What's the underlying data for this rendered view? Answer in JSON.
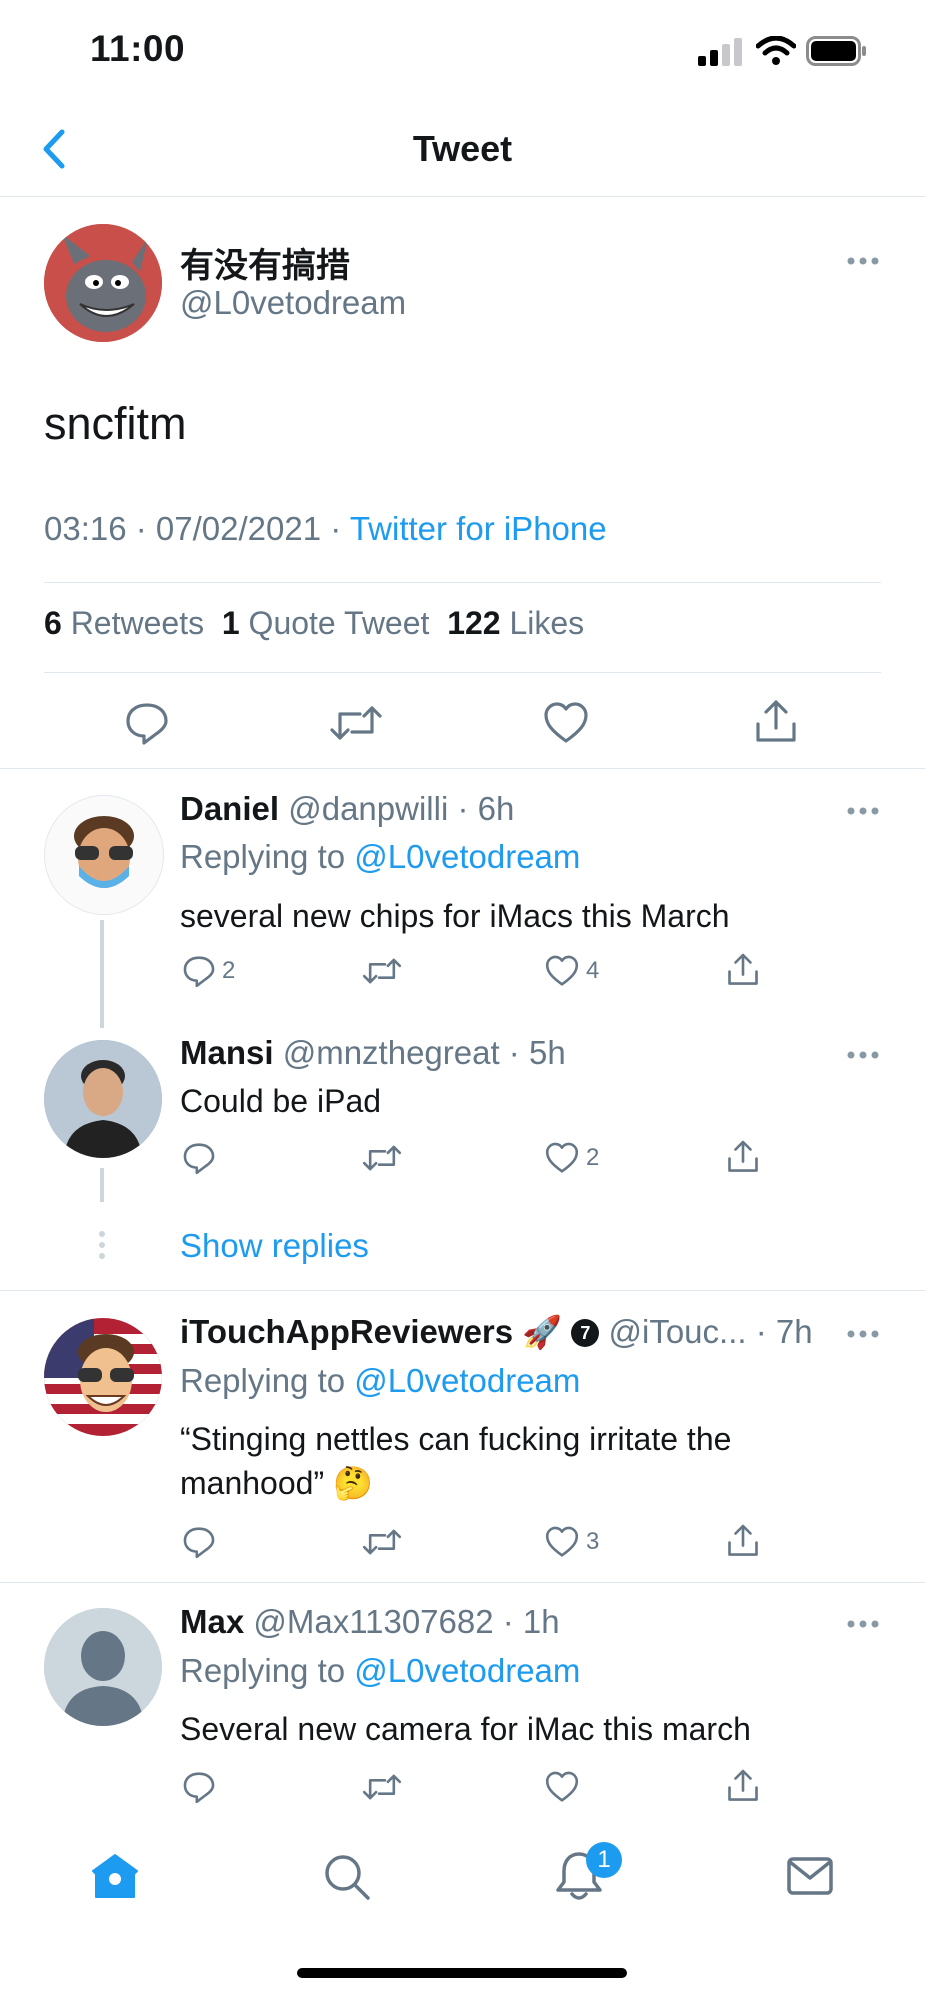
{
  "status_bar": {
    "time": "11:00"
  },
  "header": {
    "title": "Tweet"
  },
  "main_tweet": {
    "display_name": "有没有搞措",
    "handle": "@L0vetodream",
    "text": "sncfitm",
    "time": "03:16",
    "date": "07/02/2021",
    "source": "Twitter for iPhone",
    "stats": {
      "retweets_count": "6",
      "retweets_label": "Retweets",
      "quote_count": "1",
      "quote_label": "Quote Tweet",
      "likes_count": "122",
      "likes_label": "Likes"
    }
  },
  "replies": [
    {
      "name": "Daniel",
      "handle": "@danpwilli",
      "time": "6h",
      "replying_label": "Replying to",
      "replying_handle": "@L0vetodream",
      "text": "several new chips for iMacs this March",
      "reply_count": "2",
      "like_count": "4"
    },
    {
      "name": "Mansi",
      "handle": "@mnzthegreat",
      "time": "5h",
      "text": "Could be iPad",
      "like_count": "2"
    },
    {
      "name": "iTouchAppReviewers",
      "name_emoji": "🚀",
      "badge": "7",
      "handle": "@iTouc...",
      "time": "7h",
      "replying_label": "Replying to",
      "replying_handle": "@L0vetodream",
      "text_line1": "“Stinging nettles can fucking irritate the",
      "text_line2": "manhood”",
      "text_emoji": "🤔",
      "like_count": "3"
    },
    {
      "name": "Max",
      "handle": "@Max11307682",
      "time": "1h",
      "replying_label": "Replying to",
      "replying_handle": "@L0vetodream",
      "text": "Several new camera for iMac this march"
    }
  ],
  "show_replies": "Show replies",
  "tab_bar": {
    "notifications_badge": "1"
  },
  "colors": {
    "accent": "#1d9bf0",
    "muted": "#657786",
    "divider": "#e1e8ed"
  }
}
